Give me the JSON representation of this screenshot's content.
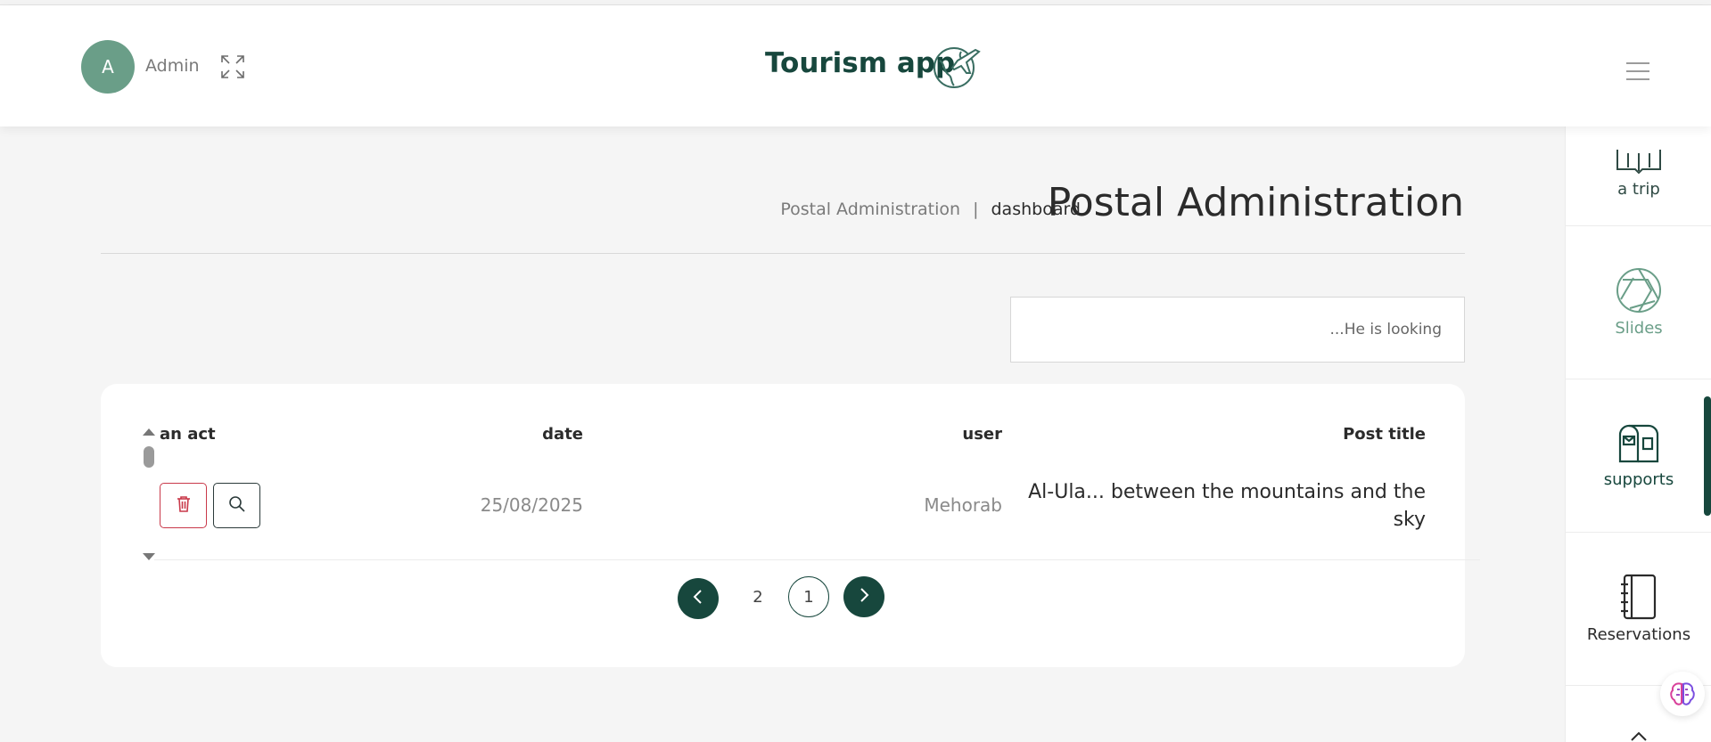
{
  "header": {
    "avatar_initial": "A",
    "user_name": "Admin",
    "app_title": "Tourism app"
  },
  "sidebar": {
    "items": [
      {
        "label": "a trip",
        "icon": "book-open-icon"
      },
      {
        "label": "Slides",
        "icon": "aperture-icon"
      },
      {
        "label": "supports",
        "icon": "mailbox-icon"
      },
      {
        "label": "Reservations",
        "icon": "notebook-icon"
      }
    ]
  },
  "page": {
    "title": "Postal Administration",
    "breadcrumb": {
      "parent": "Postal Administration",
      "separator": "|",
      "current": "dashboard"
    }
  },
  "search": {
    "placeholder": "...He is looking",
    "value": ""
  },
  "table": {
    "columns": {
      "action": "an act",
      "date": "date",
      "user": "user",
      "post_title": "Post title"
    },
    "rows": [
      {
        "date": "25/08/2025",
        "user": "Mehorab",
        "post_title_line1": "Al-Ula... between the mountains and the",
        "post_title_line2": "sky"
      }
    ]
  },
  "pagination": {
    "page_a": "2",
    "page_b": "1",
    "current": "1"
  },
  "colors": {
    "brand": "#17473d",
    "accent_green": "#6a9e88",
    "danger": "#c9394a"
  }
}
